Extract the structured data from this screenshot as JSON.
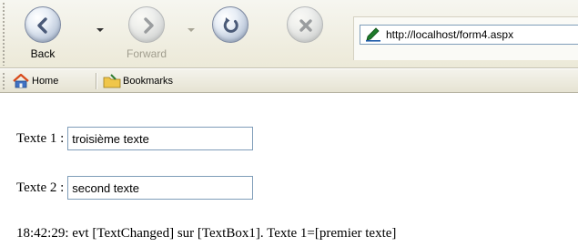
{
  "nav_toolbar": {
    "back_label": "Back",
    "forward_label": "Forward",
    "address_value": "http://localhost/form4.aspx"
  },
  "bookmarks_toolbar": {
    "home_label": "Home",
    "bookmarks_label": "Bookmarks"
  },
  "form": {
    "texte1_label": "Texte 1 :",
    "texte1_value": "troisième texte",
    "texte2_label": "Texte 2 :",
    "texte2_value": "second texte"
  },
  "log": {
    "message": "18:42:29: evt [TextChanged] sur [TextBox1]. Texte 1=[premier texte]"
  },
  "colors": {
    "toolbar_bg": "#ece9d8",
    "input_border": "#7f9db9",
    "home_icon_roof": "#d84a1b",
    "address_icon": "#1d7a2a"
  }
}
